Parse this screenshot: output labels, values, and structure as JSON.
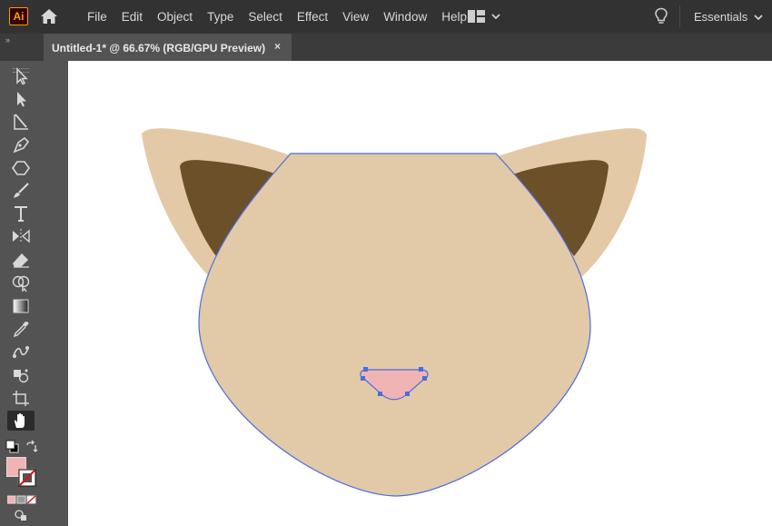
{
  "app": {
    "logo_text": "Ai"
  },
  "menu": {
    "items": [
      "File",
      "Edit",
      "Object",
      "Type",
      "Select",
      "Effect",
      "View",
      "Window",
      "Help"
    ]
  },
  "workspace": {
    "label": "Essentials"
  },
  "document": {
    "tab_title": "Untitled-1* @ 66.67% (RGB/GPU Preview)",
    "close_glyph": "×"
  },
  "toolbar": {
    "collapse_glyph": "»",
    "tools": [
      "selection-tool",
      "direct-selection-tool",
      "line-segment-tool",
      "pen-tool",
      "polygon-tool",
      "paintbrush-tool",
      "type-tool",
      "reflect-tool",
      "eraser-tool",
      "shape-builder-tool",
      "gradient-tool",
      "eyedropper-tool",
      "blend-tool",
      "symbol-sprayer-tool",
      "artboard-tool",
      "hand-tool"
    ],
    "active_tool": "hand-tool",
    "fill_color": "#f0b4b4",
    "stroke_color": "none"
  },
  "colors": {
    "menubar": "#323232",
    "canvas": "#535353",
    "artboard": "#ffffff",
    "selection": "#4a6ee0",
    "ear_outer": "#e3c9a6",
    "ear_inner": "#6b5029",
    "head": "#e2c9a8",
    "nose": "#f0b4b4"
  }
}
